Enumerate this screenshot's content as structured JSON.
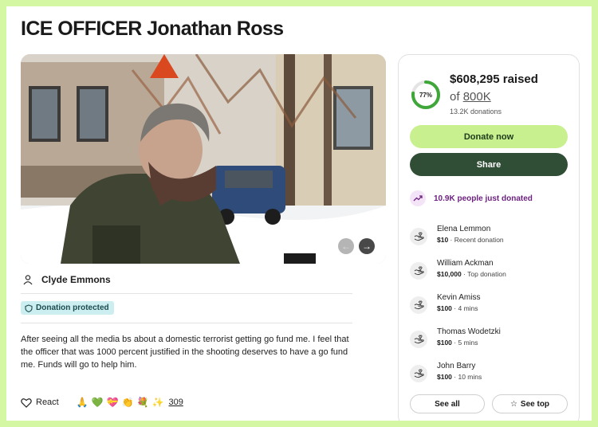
{
  "campaign": {
    "title": "ICE OFFICER Jonathan Ross",
    "organizer": "Clyde Emmons",
    "protected_badge": "Donation protected",
    "story": "After seeing all the media bs about a domestic terrorist getting go fund me. I feel that the officer that was 1000 percent justified in the shooting deserves to have a go fund me. Funds will go to help him.",
    "react_label": "React",
    "reactions": [
      "🙏",
      "💚",
      "💝",
      "👏",
      "💐",
      "✨"
    ],
    "reaction_count": "309"
  },
  "progress": {
    "percent_label": "77%",
    "percent": 0.77,
    "raised": "$608,295 raised",
    "goal_prefix": "of",
    "goal": "800K",
    "donations": "13.2K donations"
  },
  "actions": {
    "donate": "Donate now",
    "share": "Share",
    "see_all": "See all",
    "see_top": "See top"
  },
  "trending": "10.9K people just donated",
  "donors": [
    {
      "name": "Elena Lemmon",
      "amount": "$10",
      "note": " · Recent donation"
    },
    {
      "name": "William Ackman",
      "amount": "$10,000",
      "note": " · Top donation"
    },
    {
      "name": "Kevin Amiss",
      "amount": "$100",
      "note": " · 4 mins"
    },
    {
      "name": "Thomas Wodetzki",
      "amount": "$100",
      "note": " · 5 mins"
    },
    {
      "name": "John Barry",
      "amount": "$100",
      "note": " · 10 mins"
    }
  ],
  "colors": {
    "brand_green": "#c9f08e",
    "share_dark": "#2f4e35",
    "progress_green": "#3fa63a",
    "trend_purple": "#6d2180",
    "page_bg": "#d4f7a3"
  }
}
